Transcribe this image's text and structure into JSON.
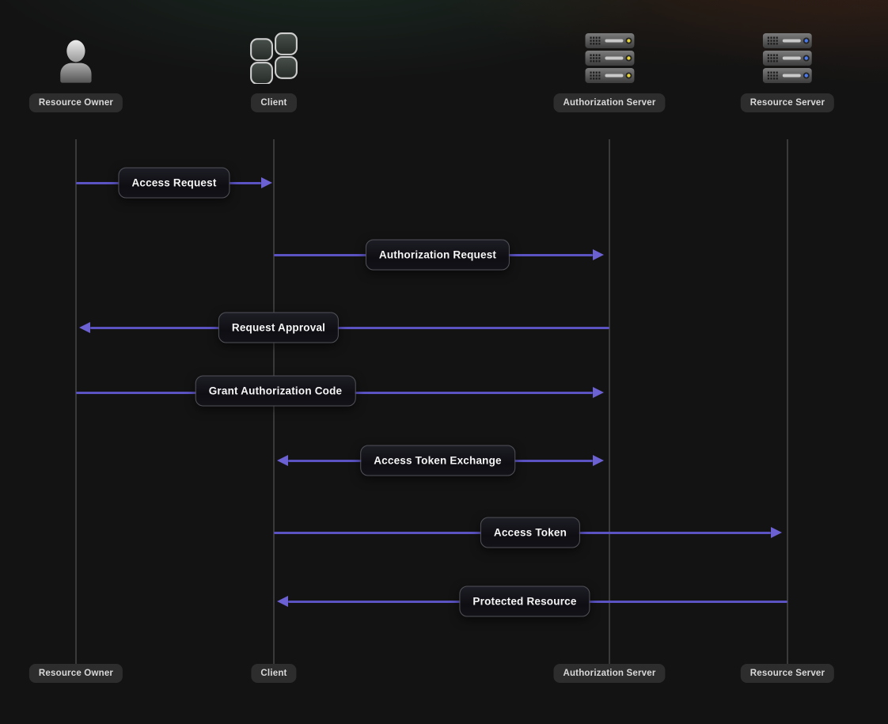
{
  "actors": [
    {
      "label": "Resource Owner",
      "icon": "user-icon"
    },
    {
      "label": "Client",
      "icon": "app-grid-icon"
    },
    {
      "label": "Authorization Server",
      "icon": "server-stack-icon",
      "led": "yellow"
    },
    {
      "label": "Resource Server",
      "icon": "server-stack-icon",
      "led": "blue"
    }
  ],
  "messages": [
    {
      "label": "Access Request",
      "from": "Resource Owner",
      "to": "Client",
      "direction": "right"
    },
    {
      "label": "Authorization Request",
      "from": "Client",
      "to": "Authorization Server",
      "direction": "right"
    },
    {
      "label": "Request Approval",
      "from": "Authorization Server",
      "to": "Resource Owner",
      "direction": "left"
    },
    {
      "label": "Grant Authorization Code",
      "from": "Resource Owner",
      "to": "Authorization Server",
      "direction": "right"
    },
    {
      "label": "Access Token Exchange",
      "from": "Client",
      "to": "Authorization Server",
      "direction": "both"
    },
    {
      "label": "Access Token",
      "from": "Client",
      "to": "Resource Server",
      "direction": "right"
    },
    {
      "label": "Protected Resource",
      "from": "Resource Server",
      "to": "Client",
      "direction": "left"
    }
  ],
  "colors": {
    "arrow": "#5b53c2",
    "arrowhead": "#6c61d2",
    "lifeline": "#3a3a3a",
    "badge_background": "#2d2d2d",
    "badge_text": "#d9d9d9",
    "label_box_border": "#52525a",
    "label_text": "#f5f5f5",
    "led_yellow": "#e6d23a",
    "led_blue": "#4a7bf5"
  }
}
